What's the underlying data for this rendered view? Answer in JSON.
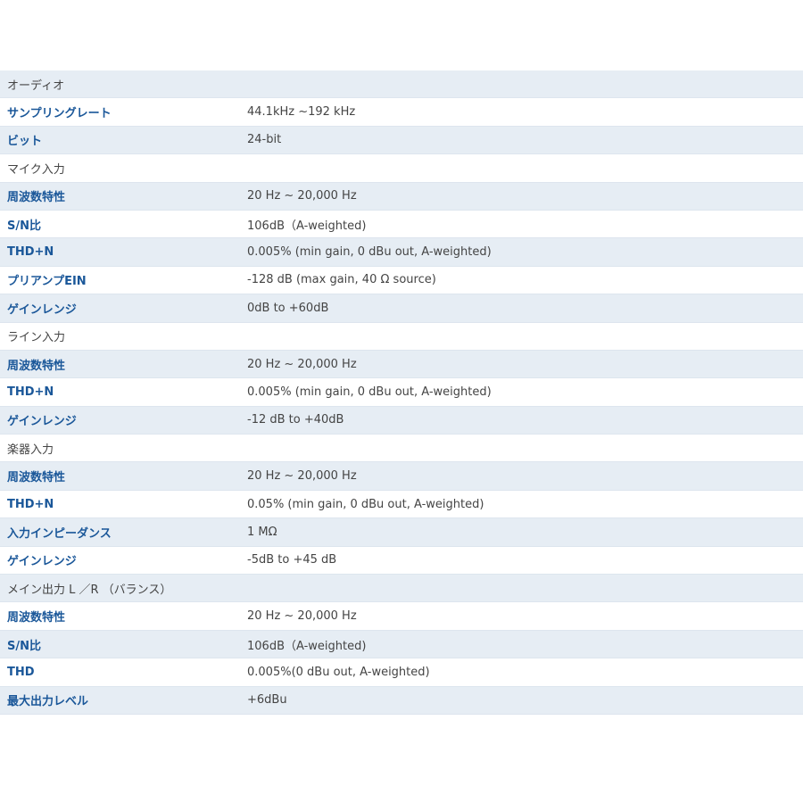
{
  "spec_table": {
    "rows": [
      {
        "type": "section",
        "label": "オーディオ",
        "value": ""
      },
      {
        "type": "spec",
        "label": "サンプリングレート",
        "value": "44.1kHz ~192 kHz"
      },
      {
        "type": "spec",
        "label": "ビット",
        "value": "24-bit"
      },
      {
        "type": "section",
        "label": "マイク入力",
        "value": ""
      },
      {
        "type": "spec",
        "label": "周波数特性",
        "value": "20 Hz ~ 20,000 Hz"
      },
      {
        "type": "spec",
        "label": "S/N比",
        "value": "106dB（A-weighted)"
      },
      {
        "type": "spec",
        "label": "THD+N",
        "value": "0.005% (min gain, 0 dBu out, A-weighted)"
      },
      {
        "type": "spec",
        "label": "プリアンプEIN",
        "value": "-128 dB (max gain, 40 Ω source)"
      },
      {
        "type": "spec",
        "label": "ゲインレンジ",
        "value": "0dB to +60dB"
      },
      {
        "type": "section",
        "label": "ライン入力",
        "value": ""
      },
      {
        "type": "spec",
        "label": "周波数特性",
        "value": "20 Hz ~ 20,000 Hz"
      },
      {
        "type": "spec",
        "label": "THD+N",
        "value": "0.005% (min gain, 0 dBu out, A-weighted)"
      },
      {
        "type": "spec",
        "label": "ゲインレンジ",
        "value": "-12 dB to +40dB"
      },
      {
        "type": "section",
        "label": "楽器入力",
        "value": ""
      },
      {
        "type": "spec",
        "label": "周波数特性",
        "value": "20 Hz ~ 20,000 Hz"
      },
      {
        "type": "spec",
        "label": "THD+N",
        "value": "0.05% (min gain, 0 dBu out, A-weighted)"
      },
      {
        "type": "spec",
        "label": "入力インピーダンス",
        "value": "1 MΩ"
      },
      {
        "type": "spec",
        "label": "ゲインレンジ",
        "value": "-5dB to +45 dB"
      },
      {
        "type": "section",
        "label": "メイン出力 L ／R （バランス）",
        "value": ""
      },
      {
        "type": "spec",
        "label": "周波数特性",
        "value": "20 Hz ~ 20,000 Hz"
      },
      {
        "type": "spec",
        "label": "S/N比",
        "value": "106dB（A-weighted)"
      },
      {
        "type": "spec",
        "label": "THD",
        "value": "0.005%(0 dBu out, A-weighted)"
      },
      {
        "type": "spec",
        "label": "最大出力レベル",
        "value": "+6dBu"
      }
    ]
  }
}
